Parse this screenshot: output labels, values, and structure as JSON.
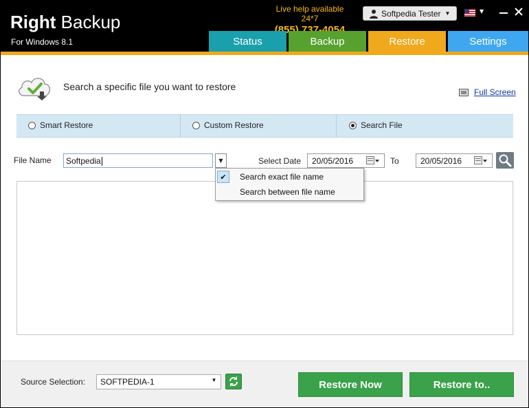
{
  "header": {
    "brand_bold": "Right",
    "brand_rest": "Backup",
    "subtitle": "For Windows 8.1",
    "help_line": "Live help available 24*7",
    "help_phone": "(855) 737-4054",
    "user_name": "Softpedia Tester",
    "language_flag_icon": "us-flag-icon"
  },
  "tabs": [
    {
      "label": "Status",
      "color": "#1aa0ac"
    },
    {
      "label": "Backup",
      "color": "#57a22e"
    },
    {
      "label": "Restore",
      "color": "#f0a81c",
      "active": true
    },
    {
      "label": "Settings",
      "color": "#3fa7f0"
    }
  ],
  "content": {
    "title": "Search a specific file you want to restore",
    "full_screen_label": "Full Screen",
    "modes": [
      {
        "label": "Smart Restore",
        "selected": false
      },
      {
        "label": "Custom Restore",
        "selected": false
      },
      {
        "label": "Search File",
        "selected": true
      }
    ],
    "file_name_label": "File Name",
    "file_name_value": "Softpedia",
    "select_date_label": "Select Date",
    "date_from": "20/05/2016",
    "to_label": "To",
    "date_to": "20/05/2016",
    "match_options": [
      {
        "label": "Search exact file name",
        "checked": true
      },
      {
        "label": "Search between file name",
        "checked": false
      }
    ]
  },
  "footer": {
    "source_label": "Source Selection:",
    "source_value": "SOFTPEDIA-1",
    "restore_now_label": "Restore Now",
    "restore_to_label": "Restore to.."
  },
  "colors": {
    "accent": "#f0a81c",
    "button_green": "#3aa24a",
    "mode_bar": "#d4e8f4"
  }
}
